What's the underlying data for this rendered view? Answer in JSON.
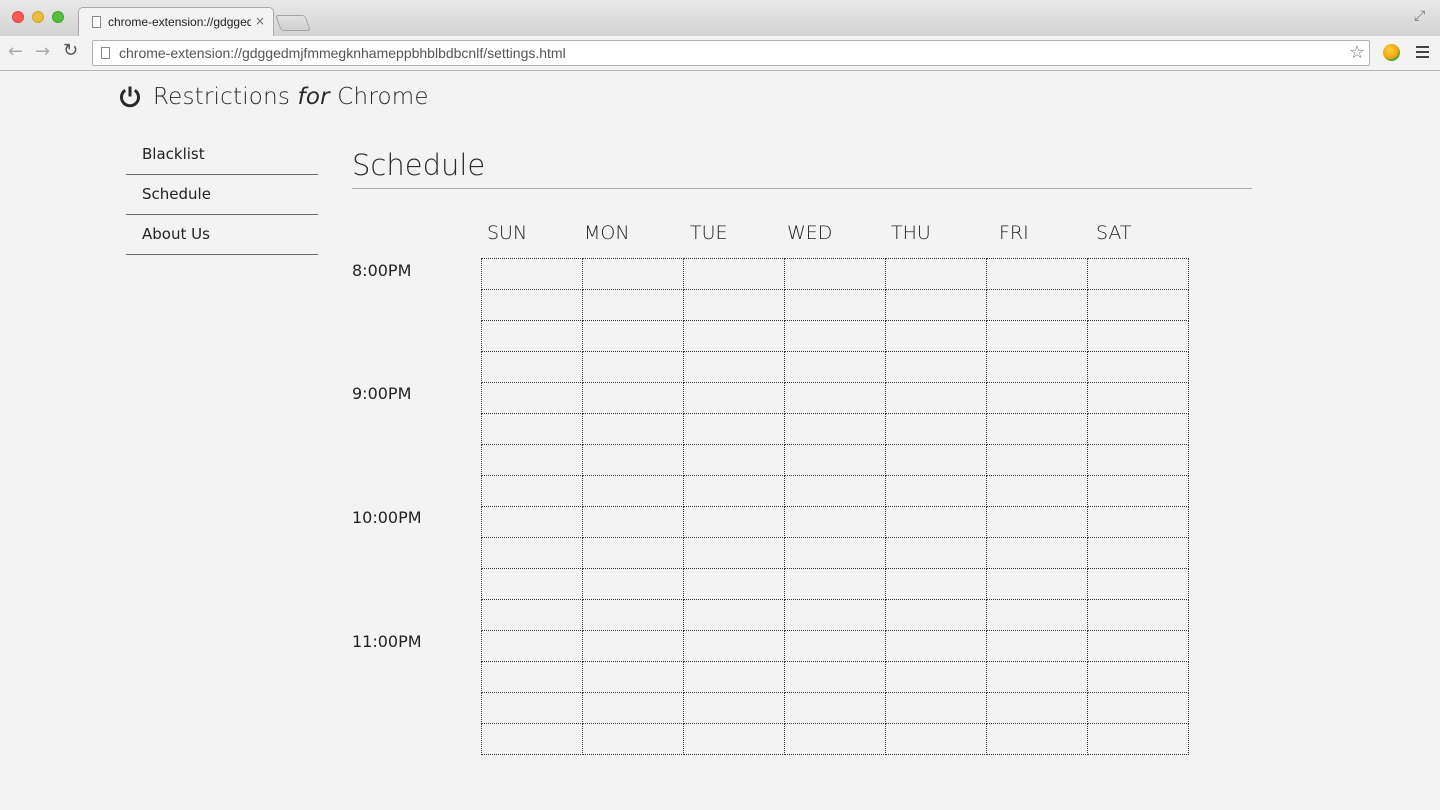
{
  "browser": {
    "tab_title": "chrome-extension://gdggedmjfmmegknhameppbhblbdbcnlf/settings.html",
    "tab_close": "×",
    "url": "chrome-extension://gdggedmjfmmegknhameppbhblbdbcnlf/settings.html",
    "back_icon": "←",
    "forward_icon": "→",
    "reload_icon": "↻",
    "star_icon": "☆",
    "fullscreen_icon": "⤢"
  },
  "brand": {
    "prefix": "Restrictions ",
    "italic": "for",
    "suffix": " Chrome"
  },
  "sidebar": {
    "items": [
      {
        "label": "Blacklist"
      },
      {
        "label": "Schedule"
      },
      {
        "label": "About Us"
      }
    ]
  },
  "main": {
    "title": "Schedule"
  },
  "schedule": {
    "days": [
      "SUN",
      "MON",
      "TUE",
      "WED",
      "THU",
      "FRI",
      "SAT"
    ],
    "times": [
      "8:00PM",
      "9:00PM",
      "10:00PM",
      "11:00PM"
    ]
  },
  "colors": {
    "background": "#f3f3f3",
    "text": "#222222",
    "grid_line": "#333333"
  }
}
